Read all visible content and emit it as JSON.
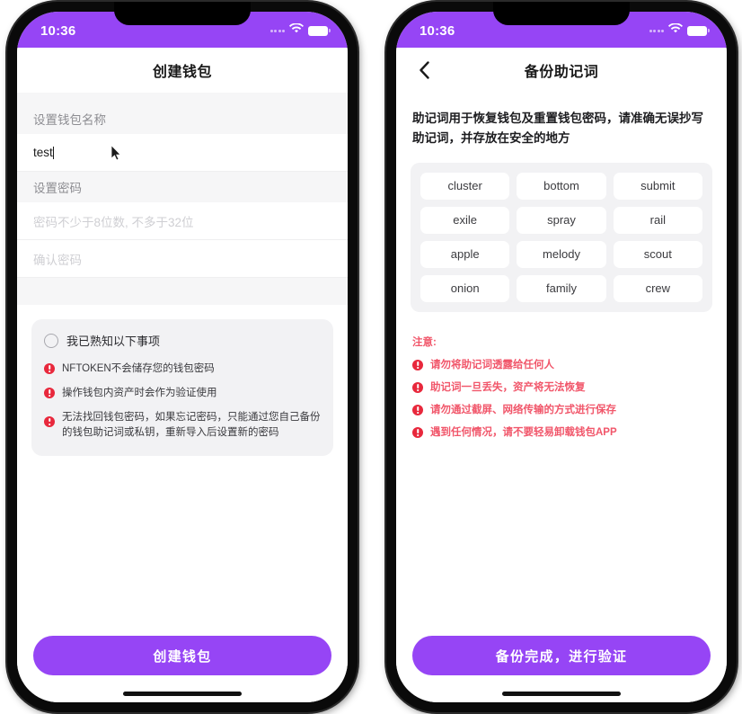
{
  "theme": {
    "accent": "#9645f5",
    "warning_red": "#e8283c",
    "note_red": "#f1566a",
    "panel_gray": "#f2f2f4",
    "section_gray": "#f6f6f7"
  },
  "left_phone": {
    "status_bar": {
      "time": "10:36",
      "signal_icon": "signal-dots-icon",
      "wifi_icon": "wifi-icon",
      "battery_icon": "battery-icon"
    },
    "nav": {
      "title": "创建钱包"
    },
    "form": {
      "name_label": "设置钱包名称",
      "name_value": "test",
      "password_label": "设置密码",
      "password_placeholder": "密码不少于8位数, 不多于32位",
      "confirm_placeholder": "确认密码"
    },
    "notice": {
      "agree_label": "我已熟知以下事项",
      "agree_checked": false,
      "bullets": [
        "NFTOKEN不会储存您的钱包密码",
        "操作钱包内资产时会作为验证使用",
        "无法找回钱包密码，如果忘记密码，只能通过您自己备份的钱包助记词或私钥，重新导入后设置新的密码"
      ]
    },
    "cta": {
      "label": "创建钱包"
    }
  },
  "right_phone": {
    "status_bar": {
      "time": "10:36",
      "signal_icon": "signal-dots-icon",
      "wifi_icon": "wifi-icon",
      "battery_icon": "battery-icon"
    },
    "nav": {
      "back_icon": "chevron-left-icon",
      "title": "备份助记词"
    },
    "description": "助记词用于恢复钱包及重置钱包密码，请准确无误抄写助记词，并存放在安全的地方",
    "mnemonic_words": [
      "cluster",
      "bottom",
      "submit",
      "exile",
      "spray",
      "rail",
      "apple",
      "melody",
      "scout",
      "onion",
      "family",
      "crew"
    ],
    "notes": {
      "title": "注意:",
      "items": [
        "请勿将助记词透露给任何人",
        "助记词一旦丢失，资产将无法恢复",
        "请勿通过截屏、网络传输的方式进行保存",
        "遇到任何情况，请不要轻易卸载钱包APP"
      ]
    },
    "cta": {
      "label": "备份完成，进行验证"
    }
  }
}
